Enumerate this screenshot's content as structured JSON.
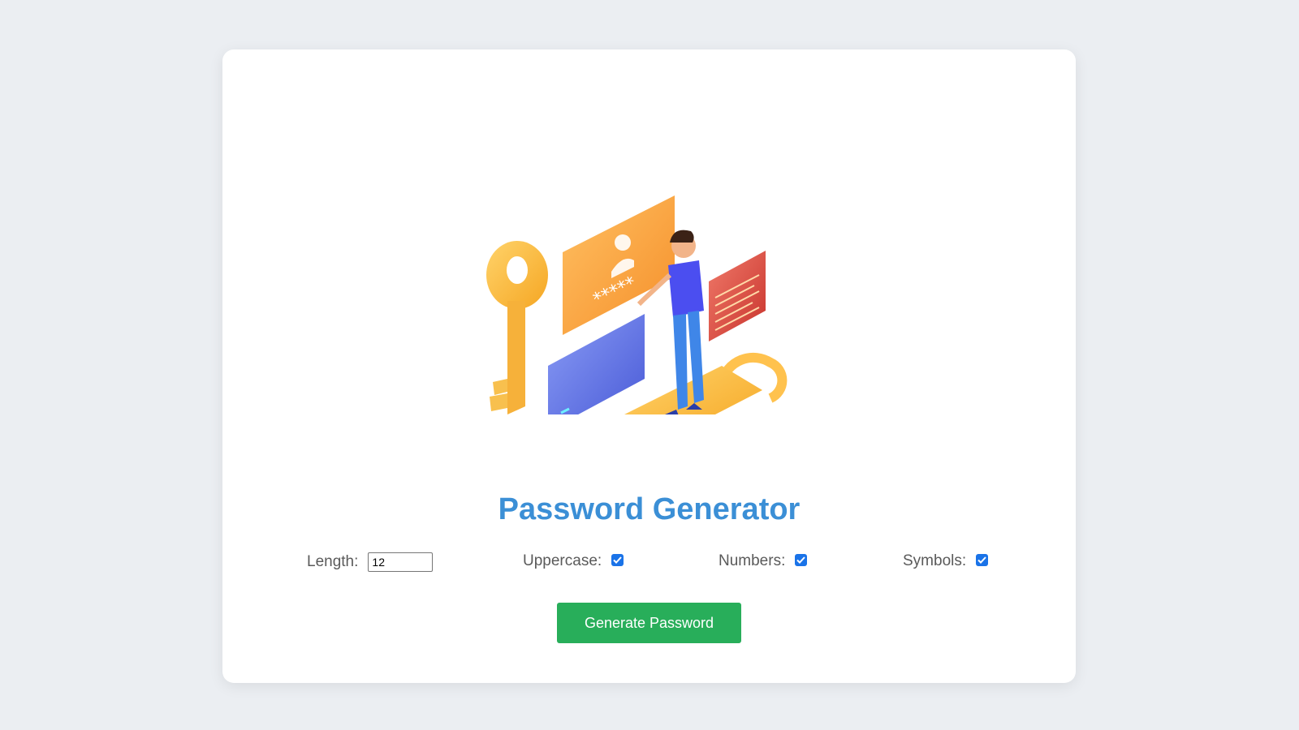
{
  "app": {
    "title": "Password Generator"
  },
  "options": {
    "length": {
      "label": "Length:",
      "value": "12"
    },
    "uppercase": {
      "label": "Uppercase:",
      "checked": true
    },
    "numbers": {
      "label": "Numbers:",
      "checked": true
    },
    "symbols": {
      "label": "Symbols:",
      "checked": true
    }
  },
  "actions": {
    "generate_label": "Generate Password"
  },
  "illustration": {
    "password_mask": "*****",
    "icons": [
      "key-icon",
      "login-card-icon",
      "person-icon",
      "padlock-icon",
      "code-panel-icon",
      "screen-panel-icon"
    ]
  },
  "colors": {
    "background": "#ebeef2",
    "card": "#ffffff",
    "title": "#3b8fd6",
    "button": "#28ae5a",
    "checkbox": "#1a73e8"
  }
}
